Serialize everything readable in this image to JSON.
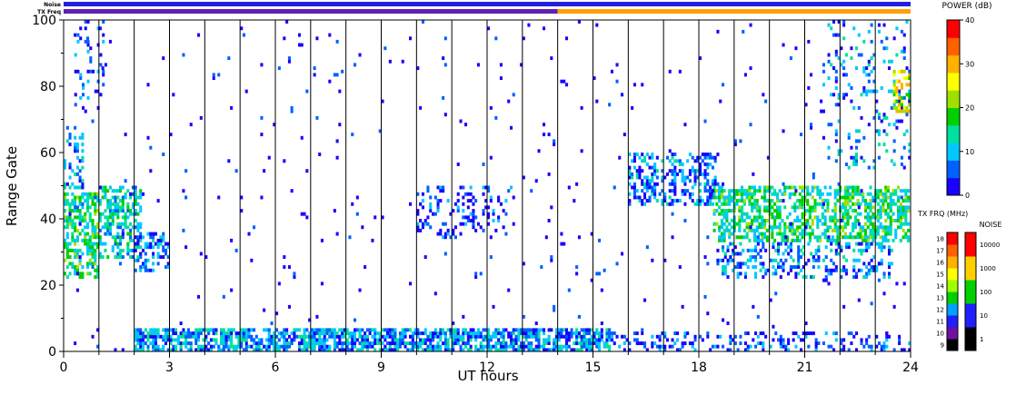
{
  "chart_data": {
    "type": "heatmap",
    "title": "",
    "xlabel": "UT hours",
    "ylabel": "Range Gate",
    "xlim": [
      0,
      24
    ],
    "ylim": [
      0,
      100
    ],
    "xticks": [
      "0",
      "3",
      "6",
      "9",
      "12",
      "15",
      "18",
      "21",
      "24"
    ],
    "yticks": [
      "0",
      "20",
      "40",
      "60",
      "80",
      "100"
    ],
    "grid": "vertical lines every 1 UT hour",
    "top_strips": [
      {
        "label": "Noise",
        "segments": [
          {
            "x0": 0,
            "x1": 24,
            "color": "#2020e0"
          }
        ]
      },
      {
        "label": "TX Freq",
        "segments": [
          {
            "x0": 0,
            "x1": 14,
            "color": "#6020b0"
          },
          {
            "x0": 14,
            "x1": 24,
            "color": "#ffa000"
          }
        ]
      }
    ],
    "power_scale": {
      "label": "POWER (dB)",
      "ticks": [
        "0",
        "10",
        "20",
        "30",
        "40"
      ],
      "colors": [
        "#1a00ff",
        "#0060ff",
        "#00c8ff",
        "#00e0a0",
        "#00d000",
        "#a0e000",
        "#ffff00",
        "#ffb000",
        "#ff6000",
        "#ff0000"
      ]
    },
    "txfrq_scale": {
      "label": "TX FRQ (MHz)",
      "ticks": [
        "9",
        "10",
        "11",
        "12",
        "13",
        "14",
        "15",
        "16",
        "17",
        "18"
      ],
      "colors": [
        "#000000",
        "#7010a0",
        "#2020ff",
        "#00a0ff",
        "#00d000",
        "#a0ff00",
        "#ffff00",
        "#ffb000",
        "#ff6000",
        "#ff0000"
      ]
    },
    "noise_scale": {
      "label": "NOISE",
      "ticks": [
        "1",
        "10",
        "100",
        "1000",
        "10000"
      ],
      "colors": [
        "#000000",
        "#2020ff",
        "#00d000",
        "#ffd000",
        "#ff0000"
      ]
    },
    "series": [
      {
        "x0": 0.0,
        "x1": 1.0,
        "y0": 22,
        "y1": 48,
        "power": 15,
        "density": 0.55
      },
      {
        "x0": 1.0,
        "x1": 2.2,
        "y0": 28,
        "y1": 50,
        "power": 12,
        "density": 0.5
      },
      {
        "x0": 2.0,
        "x1": 3.0,
        "y0": 24,
        "y1": 36,
        "power": 6,
        "density": 0.35
      },
      {
        "x0": 0.0,
        "x1": 0.6,
        "y0": 48,
        "y1": 68,
        "power": 8,
        "density": 0.3
      },
      {
        "x0": 0.3,
        "x1": 1.2,
        "y0": 72,
        "y1": 100,
        "power": 5,
        "density": 0.12
      },
      {
        "x0": 2.0,
        "x1": 15.5,
        "y0": 0,
        "y1": 7,
        "power": 8,
        "density": 0.7
      },
      {
        "x0": 15.5,
        "x1": 24.0,
        "y0": 0,
        "y1": 6,
        "power": 4,
        "density": 0.25
      },
      {
        "x0": 10.0,
        "x1": 12.8,
        "y0": 34,
        "y1": 50,
        "power": 3,
        "density": 0.2
      },
      {
        "x0": 16.0,
        "x1": 18.6,
        "y0": 44,
        "y1": 60,
        "power": 6,
        "density": 0.35
      },
      {
        "x0": 18.4,
        "x1": 24.0,
        "y0": 33,
        "y1": 50,
        "power": 15,
        "density": 0.55
      },
      {
        "x0": 18.5,
        "x1": 23.5,
        "y0": 22,
        "y1": 33,
        "power": 7,
        "density": 0.3
      },
      {
        "x0": 21.5,
        "x1": 24.0,
        "y0": 55,
        "y1": 100,
        "power": 8,
        "density": 0.12
      },
      {
        "x0": 23.5,
        "x1": 24.0,
        "y0": 72,
        "y1": 85,
        "power": 25,
        "density": 0.5
      },
      {
        "x0": 0.0,
        "x1": 24.0,
        "y0": 0,
        "y1": 100,
        "power": 1,
        "density": 0.012
      }
    ]
  }
}
